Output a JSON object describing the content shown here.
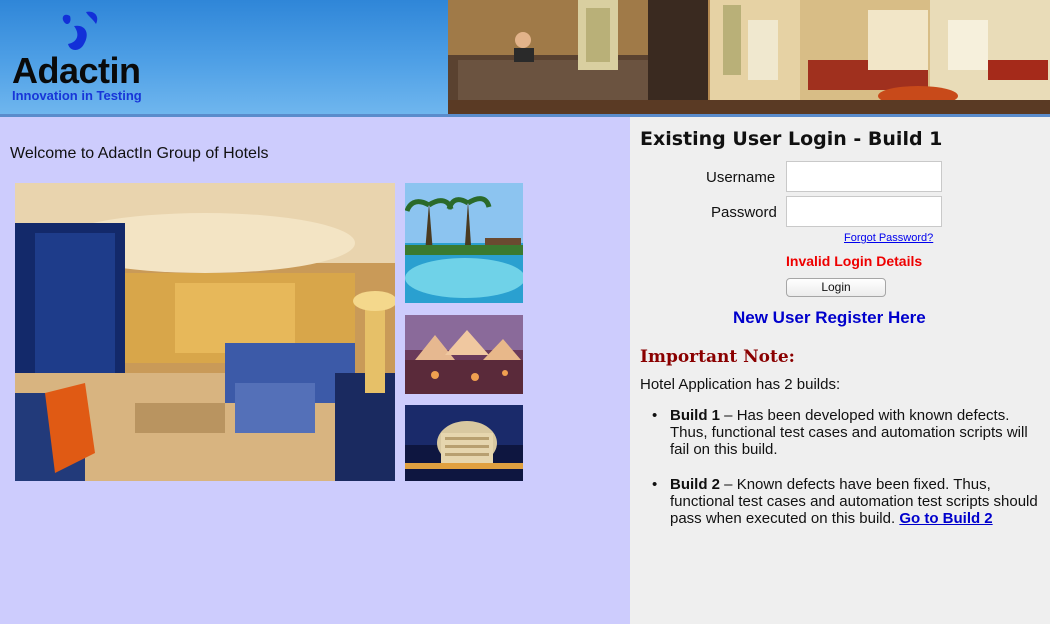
{
  "header": {
    "logo_word": "Adactin",
    "logo_tagline": "Innovation in Testing"
  },
  "main": {
    "welcome": "Welcome to AdactIn Group of Hotels"
  },
  "login": {
    "title": "Existing User Login - Build 1",
    "username_label": "Username",
    "password_label": "Password",
    "username_value": "",
    "password_value": "",
    "forgot_password": "Forgot Password?",
    "error": "Invalid Login Details",
    "login_button": "Login",
    "register_link": "New User Register Here"
  },
  "note": {
    "title": "Important Note:",
    "intro": "Hotel Application has 2 builds:",
    "build1_label": "Build 1",
    "build1_text": " – Has been developed with known defects. Thus, functional test cases and automation scripts will fail on this build.",
    "build2_label": "Build 2",
    "build2_text": " – Known defects have been fixed. Thus, functional test cases and automation test scripts should pass when executed on this build. ",
    "build2_link": "Go to Build 2"
  },
  "colors": {
    "left_panel_bg": "#cdccfd",
    "right_panel_bg": "#efefef",
    "error_red": "#ee0000",
    "note_title": "#8a0000",
    "link_blue": "#0000cc"
  }
}
